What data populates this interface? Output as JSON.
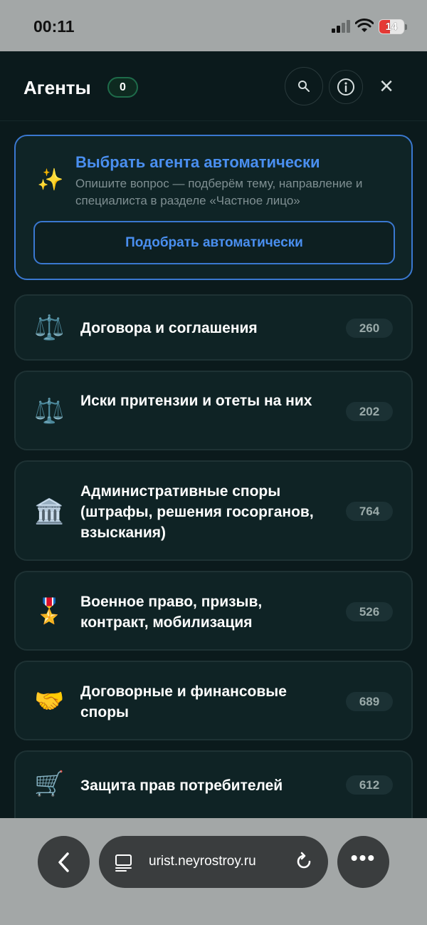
{
  "status_bar": {
    "time": "00:11",
    "battery": "14",
    "battery_level_percent": 14
  },
  "header": {
    "title": "Агенты",
    "count": "0",
    "icons": [
      "search-icon",
      "info-icon",
      "close-icon"
    ],
    "close_glyph": "×"
  },
  "auto_select": {
    "icon": "sparkle-icon",
    "title": "Выбрать агента автоматически",
    "description": "Опишите вопрос — подберём тему, направление и специалиста в разделе «Частное лицо»",
    "button_label": "Подобрать автоматически"
  },
  "categories": [
    {
      "icon": "⚖️",
      "icon_name": "scales-icon",
      "label": "Договора и соглашения",
      "count": "260"
    },
    {
      "icon": "⚖️",
      "icon_name": "scales-icon",
      "label": "Иски притензии и отеты на них",
      "count": "202"
    },
    {
      "icon": "🏛️",
      "icon_name": "building-icon",
      "label": "Административные споры (штрафы, решения госорганов, взыскания)",
      "count": "764"
    },
    {
      "icon": "🎖️",
      "icon_name": "medal-icon",
      "label": "Военное право, призыв, контракт, мобилизация",
      "count": "526"
    },
    {
      "icon": "🤝",
      "icon_name": "handshake-icon",
      "label": "Договорные и финансовые споры",
      "count": "689"
    },
    {
      "icon": "🛒",
      "icon_name": "cart-icon",
      "label": "Защита прав потребителей",
      "count": "612"
    }
  ],
  "browser": {
    "url": "urist.neyrostroy.ru",
    "icons": [
      "back-icon",
      "tabs-icon",
      "reload-icon",
      "more-icon"
    ]
  },
  "colors": {
    "background": "#0b1a1c",
    "card": "#0f2325",
    "accent": "#4a8ff0",
    "badge_border": "#1e6b4a"
  }
}
